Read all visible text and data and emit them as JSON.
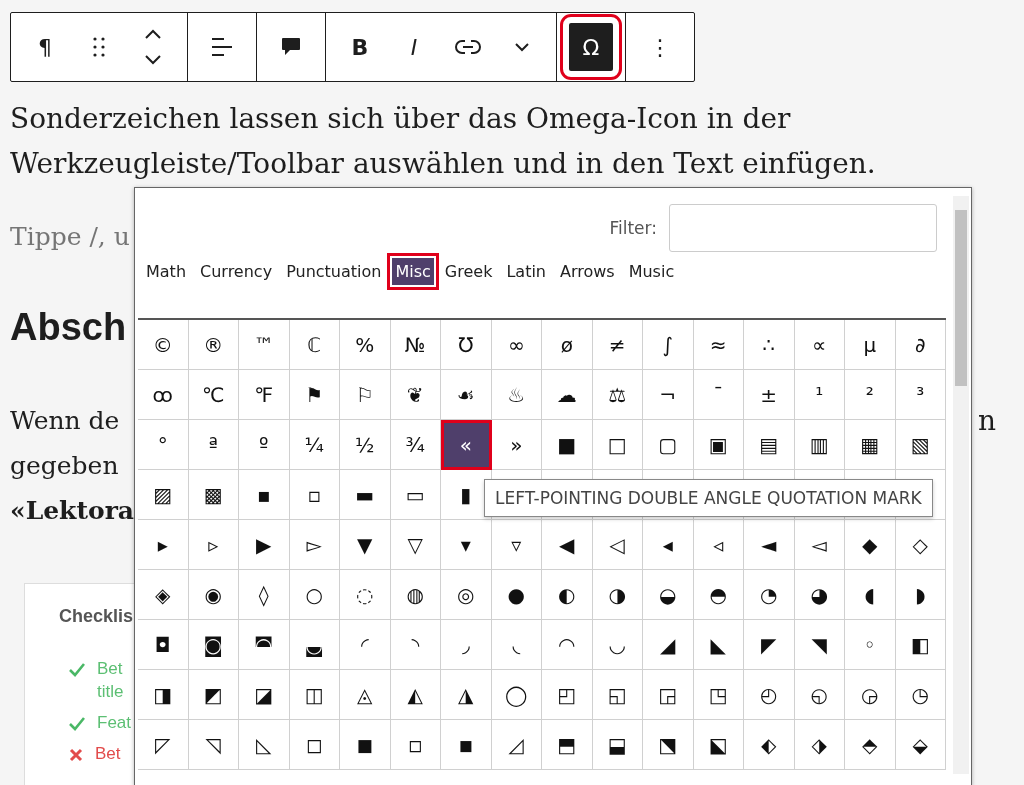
{
  "toolbar": {
    "groups": [
      [
        {
          "kind": "text",
          "label": "¶",
          "selected": false
        },
        {
          "kind": "drag",
          "selected": false
        },
        {
          "kind": "updown",
          "selected": false
        }
      ],
      [
        {
          "kind": "align",
          "selected": false
        }
      ],
      [
        {
          "kind": "comment",
          "selected": false
        }
      ],
      [
        {
          "kind": "bold",
          "label": "B",
          "selected": false
        },
        {
          "kind": "italic",
          "label": "I",
          "selected": false
        },
        {
          "kind": "link",
          "selected": false
        },
        {
          "kind": "chevron",
          "selected": false
        }
      ],
      [
        {
          "kind": "text",
          "label": "Ω",
          "selected": true
        }
      ],
      [
        {
          "kind": "text",
          "label": "⋮",
          "selected": false
        }
      ]
    ]
  },
  "intro": "Sonderzeichen lassen sich über das Omega-Icon in der Werkzeugleiste/Toolbar auswählen und in den Text einfügen.",
  "placeholder_text": "Tippe /, u",
  "heading": "Absch",
  "paragraph_lines": [
    {
      "text": "Wenn de",
      "bold": false
    },
    {
      "text": "gegeben",
      "bold": false
    },
    {
      "text": "«Lektora",
      "bold": true
    }
  ],
  "paragraph_right_fragment": "n",
  "card": {
    "title": "Checklis",
    "items": [
      {
        "passed": true,
        "lines": [
          "Bet",
          "title"
        ]
      },
      {
        "passed": true,
        "lines": [
          "Feat"
        ]
      },
      {
        "passed": false,
        "lines": [
          "Bet"
        ]
      }
    ]
  },
  "dialog": {
    "filter": {
      "label": "Filter:"
    },
    "tabs": [
      {
        "label": "Math",
        "selected": false
      },
      {
        "label": "Currency",
        "selected": false
      },
      {
        "label": "Punctuation",
        "selected": false
      },
      {
        "label": "Misc",
        "selected": true
      },
      {
        "label": "Greek",
        "selected": false
      },
      {
        "label": "Latin",
        "selected": false
      },
      {
        "label": "Arrows",
        "selected": false
      },
      {
        "label": "Music",
        "selected": false
      }
    ],
    "grid": [
      [
        {
          "char": "©",
          "selected": false
        },
        {
          "char": "®",
          "selected": false
        },
        {
          "char": "™",
          "selected": false
        },
        {
          "char": "ℂ",
          "selected": false
        },
        {
          "char": "%",
          "selected": false
        },
        {
          "char": "№",
          "selected": false
        },
        {
          "char": "℧",
          "selected": false
        },
        {
          "char": "∞",
          "selected": false
        },
        {
          "char": "ø",
          "selected": false
        },
        {
          "char": "≠",
          "selected": false
        },
        {
          "char": "∫",
          "selected": false
        },
        {
          "char": "≈",
          "selected": false
        },
        {
          "char": "∴",
          "selected": false
        },
        {
          "char": "∝",
          "selected": false
        },
        {
          "char": "µ",
          "selected": false
        },
        {
          "char": "∂",
          "selected": false
        }
      ],
      [
        {
          "char": "ꝏ",
          "selected": false
        },
        {
          "char": "℃",
          "selected": false
        },
        {
          "char": "℉",
          "selected": false
        },
        {
          "char": "⚑",
          "selected": false
        },
        {
          "char": "⚐",
          "selected": false
        },
        {
          "char": "❦",
          "selected": false
        },
        {
          "char": "☙",
          "selected": false
        },
        {
          "char": "♨",
          "selected": false
        },
        {
          "char": "☁",
          "selected": false
        },
        {
          "char": "⚖",
          "selected": false
        },
        {
          "char": "¬",
          "selected": false
        },
        {
          "char": "¯",
          "selected": false
        },
        {
          "char": "±",
          "selected": false
        },
        {
          "char": "¹",
          "selected": false
        },
        {
          "char": "²",
          "selected": false
        },
        {
          "char": "³",
          "selected": false
        }
      ],
      [
        {
          "char": "°",
          "selected": false
        },
        {
          "char": "ª",
          "selected": false
        },
        {
          "char": "º",
          "selected": false
        },
        {
          "char": "¼",
          "selected": false
        },
        {
          "char": "½",
          "selected": false
        },
        {
          "char": "¾",
          "selected": false
        },
        {
          "char": "«",
          "selected": true
        },
        {
          "char": "»",
          "selected": false
        },
        {
          "char": "■",
          "selected": false
        },
        {
          "char": "□",
          "selected": false
        },
        {
          "char": "▢",
          "selected": false
        },
        {
          "char": "▣",
          "selected": false
        },
        {
          "char": "▤",
          "selected": false
        },
        {
          "char": "▥",
          "selected": false
        },
        {
          "char": "▦",
          "selected": false
        },
        {
          "char": "▧",
          "selected": false
        }
      ],
      [
        {
          "char": "▨",
          "selected": false
        },
        {
          "char": "▩",
          "selected": false
        },
        {
          "char": "▪",
          "selected": false
        },
        {
          "char": "▫",
          "selected": false
        },
        {
          "char": "▬",
          "selected": false
        },
        {
          "char": "▭",
          "selected": false
        },
        {
          "char": "▮",
          "selected": false
        }
      ],
      [
        {
          "char": "▸",
          "selected": false
        },
        {
          "char": "▹",
          "selected": false
        },
        {
          "char": "▶",
          "selected": false
        },
        {
          "char": "▻",
          "selected": false
        },
        {
          "char": "▼",
          "selected": false
        },
        {
          "char": "▽",
          "selected": false
        },
        {
          "char": "▾",
          "selected": false
        },
        {
          "char": "▿",
          "selected": false
        },
        {
          "char": "◀",
          "selected": false
        },
        {
          "char": "◁",
          "selected": false
        },
        {
          "char": "◂",
          "selected": false
        },
        {
          "char": "◃",
          "selected": false
        },
        {
          "char": "◄",
          "selected": false
        },
        {
          "char": "◅",
          "selected": false
        },
        {
          "char": "◆",
          "selected": false
        },
        {
          "char": "◇",
          "selected": false
        }
      ],
      [
        {
          "char": "◈",
          "selected": false
        },
        {
          "char": "◉",
          "selected": false
        },
        {
          "char": "◊",
          "selected": false
        },
        {
          "char": "○",
          "selected": false
        },
        {
          "char": "◌",
          "selected": false
        },
        {
          "char": "◍",
          "selected": false
        },
        {
          "char": "◎",
          "selected": false
        },
        {
          "char": "●",
          "selected": false
        },
        {
          "char": "◐",
          "selected": false
        },
        {
          "char": "◑",
          "selected": false
        },
        {
          "char": "◒",
          "selected": false
        },
        {
          "char": "◓",
          "selected": false
        },
        {
          "char": "◔",
          "selected": false
        },
        {
          "char": "◕",
          "selected": false
        },
        {
          "char": "◖",
          "selected": false
        },
        {
          "char": "◗",
          "selected": false
        }
      ],
      [
        {
          "char": "◘",
          "selected": false
        },
        {
          "char": "◙",
          "selected": false
        },
        {
          "char": "◚",
          "selected": false
        },
        {
          "char": "◛",
          "selected": false
        },
        {
          "char": "◜",
          "selected": false
        },
        {
          "char": "◝",
          "selected": false
        },
        {
          "char": "◞",
          "selected": false
        },
        {
          "char": "◟",
          "selected": false
        },
        {
          "char": "◠",
          "selected": false
        },
        {
          "char": "◡",
          "selected": false
        },
        {
          "char": "◢",
          "selected": false
        },
        {
          "char": "◣",
          "selected": false
        },
        {
          "char": "◤",
          "selected": false
        },
        {
          "char": "◥",
          "selected": false
        },
        {
          "char": "◦",
          "selected": false
        },
        {
          "char": "◧",
          "selected": false
        }
      ],
      [
        {
          "char": "◨",
          "selected": false
        },
        {
          "char": "◩",
          "selected": false
        },
        {
          "char": "◪",
          "selected": false
        },
        {
          "char": "◫",
          "selected": false
        },
        {
          "char": "◬",
          "selected": false
        },
        {
          "char": "◭",
          "selected": false
        },
        {
          "char": "◮",
          "selected": false
        },
        {
          "char": "◯",
          "selected": false
        },
        {
          "char": "◰",
          "selected": false
        },
        {
          "char": "◱",
          "selected": false
        },
        {
          "char": "◲",
          "selected": false
        },
        {
          "char": "◳",
          "selected": false
        },
        {
          "char": "◴",
          "selected": false
        },
        {
          "char": "◵",
          "selected": false
        },
        {
          "char": "◶",
          "selected": false
        },
        {
          "char": "◷",
          "selected": false
        }
      ],
      [
        {
          "char": "◸",
          "selected": false
        },
        {
          "char": "◹",
          "selected": false
        },
        {
          "char": "◺",
          "selected": false
        },
        {
          "char": "◻",
          "selected": false
        },
        {
          "char": "◼",
          "selected": false
        },
        {
          "char": "◽",
          "selected": false
        },
        {
          "char": "◾",
          "selected": false
        },
        {
          "char": "◿",
          "selected": false
        },
        {
          "char": "⬒",
          "selected": false
        },
        {
          "char": "⬓",
          "selected": false
        },
        {
          "char": "⬔",
          "selected": false
        },
        {
          "char": "⬕",
          "selected": false
        },
        {
          "char": "⬖",
          "selected": false
        },
        {
          "char": "⬗",
          "selected": false
        },
        {
          "char": "⬘",
          "selected": false
        },
        {
          "char": "⬙",
          "selected": false
        }
      ]
    ],
    "tooltip": "LEFT-POINTING DOUBLE ANGLE QUOTATION MARK"
  }
}
